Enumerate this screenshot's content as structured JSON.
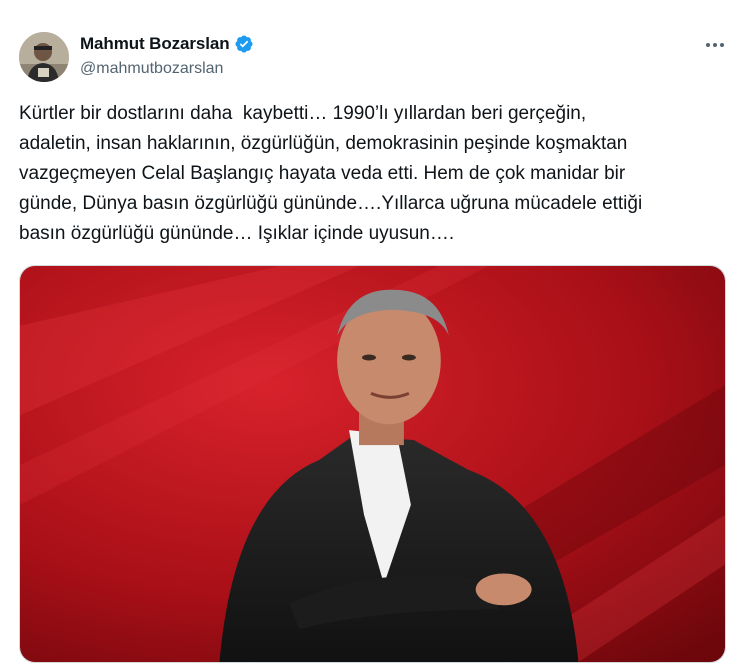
{
  "author": {
    "display_name": "Mahmut Bozarslan",
    "handle": "@mahmutbozarslan",
    "verified": true,
    "verified_color": "#1d9bf0"
  },
  "tweet": {
    "text": "Kürtler bir dostlarını daha  kaybetti… 1990’lı yıllardan beri gerçeğin,\nadaletin, insan haklarının, özgürlüğün, demokrasinin peşinde koşmaktan\nvazgeçmeyen Celal Başlangıç hayata veda etti. Hem de çok manidar bir\ngünde, Dünya basın özgürlüğü gününde….Yıllarca uğruna mücadele ettiği\nbasın özgürlüğü gününde… Işıklar içinde uyusun…."
  },
  "icons": {
    "verified": "verified-badge-icon",
    "more": "more-options-icon"
  },
  "colors": {
    "text_primary": "#0f1419",
    "text_secondary": "#536471",
    "media_background": "#b0121a"
  }
}
